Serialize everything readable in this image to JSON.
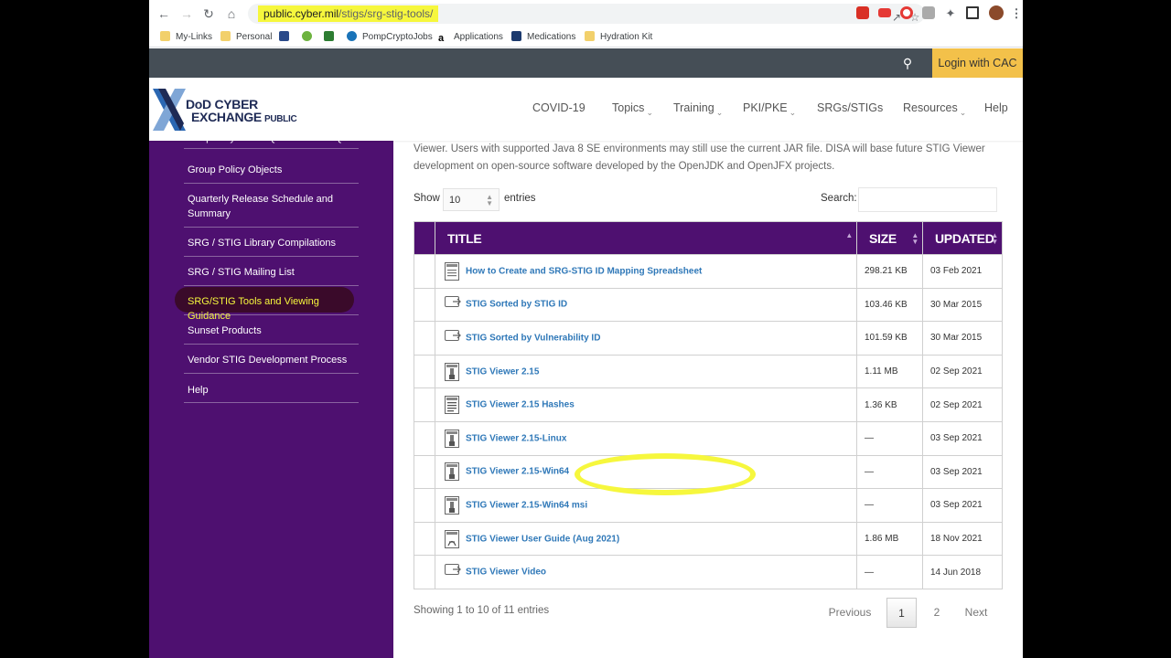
{
  "browser": {
    "url_host": "public.cyber.mil",
    "url_path": "/stigs/srg-stig-tools/",
    "bookmarks": [
      "My-Links",
      "Personal",
      "PompCryptoJobs",
      "Applications",
      "Medications",
      "Hydration Kit"
    ]
  },
  "site": {
    "login_label": "Login with CAC",
    "logo_line1": "DoD CYBER",
    "logo_line2": "EXCHANGE",
    "logo_public": "PUBLIC",
    "menu": [
      "COVID-19",
      "Topics",
      "Training",
      "PKI/PKE",
      "SRGs/STIGs",
      "Resources",
      "Help"
    ]
  },
  "sidebar": {
    "items": [
      "Frequently Asked Questions - FAQs",
      "Group Policy Objects",
      "Quarterly Release Schedule and Summary",
      "SRG / STIG Library Compilations",
      "SRG / STIG Mailing List",
      "SRG/STIG Tools and Viewing Guidance",
      "Sunset Products",
      "Vendor STIG Development Process",
      "Help"
    ]
  },
  "main": {
    "intro": "Viewer. Users with supported Java 8 SE environments may still use the current JAR file. DISA will base future STIG Viewer development on open-source software developed by the OpenJDK and OpenJFX projects.",
    "show_label": "Show",
    "entries_value": "10",
    "entries_label": "entries",
    "search_label": "Search:",
    "columns": [
      "TITLE",
      "SIZE",
      "UPDATED"
    ],
    "rows": [
      {
        "title": "How to Create and SRG-STIG ID Mapping Spreadsheet",
        "size": "298.21 KB",
        "updated": "03 Feb 2021",
        "icon": "document-icon"
      },
      {
        "title": "STIG Sorted by STIG ID",
        "size": "103.46 KB",
        "updated": "30 Mar 2015",
        "icon": "link-icon"
      },
      {
        "title": "STIG Sorted by Vulnerability ID",
        "size": "101.59 KB",
        "updated": "30 Mar 2015",
        "icon": "link-icon"
      },
      {
        "title": "STIG Viewer 2.15",
        "size": "1.11 MB",
        "updated": "02 Sep 2021",
        "icon": "zip-icon"
      },
      {
        "title": "STIG Viewer 2.15 Hashes",
        "size": "1.36 KB",
        "updated": "02 Sep 2021",
        "icon": "text-file-icon"
      },
      {
        "title": "STIG Viewer 2.15-Linux",
        "size": "—",
        "updated": "03 Sep 2021",
        "icon": "zip-icon"
      },
      {
        "title": "STIG Viewer 2.15-Win64",
        "size": "—",
        "updated": "03 Sep 2021",
        "icon": "zip-icon"
      },
      {
        "title": "STIG Viewer 2.15-Win64 msi",
        "size": "—",
        "updated": "03 Sep 2021",
        "icon": "zip-icon"
      },
      {
        "title": "STIG Viewer User Guide (Aug 2021)",
        "size": "1.86 MB",
        "updated": "18 Nov 2021",
        "icon": "pdf-icon"
      },
      {
        "title": "STIG Viewer Video",
        "size": "—",
        "updated": "14 Jun 2018",
        "icon": "link-icon"
      }
    ],
    "showing_text": "Showing 1 to 10 of 11 entries",
    "pagination": {
      "previous": "Previous",
      "pages": [
        "1",
        "2"
      ],
      "next": "Next"
    }
  },
  "colors": {
    "purple": "#4e1070",
    "gold": "#f3c14a",
    "link": "#2f78b8",
    "highlight": "#f6f73d"
  }
}
